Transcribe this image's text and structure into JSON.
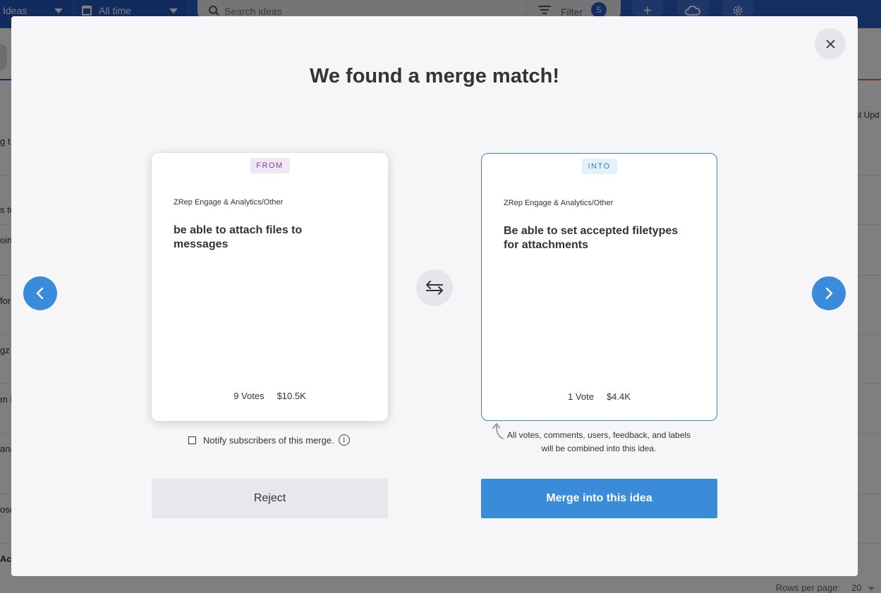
{
  "background": {
    "view_select": "Ideas",
    "date_range": "All time",
    "search_placeholder": "Search ideas",
    "filter_label": "Filter",
    "filter_count": "5",
    "column_fragment": "st Upd",
    "row_fragments": [
      "g t",
      "s to",
      "oin",
      "for",
      "gz",
      "m l",
      "ana",
      "osc",
      "Ac"
    ],
    "rows_per_page_label": "Rows per page:",
    "rows_per_page_value": "20"
  },
  "modal": {
    "title": "We found a merge match!",
    "from_card": {
      "tag": "FROM",
      "category": "ZRep Engage & Analytics/Other",
      "title": "be able to attach files to messages",
      "votes": "9 Votes",
      "value": "$10.5K"
    },
    "into_card": {
      "tag": "INTO",
      "category": "ZRep Engage & Analytics/Other",
      "title": "Be able to set accepted filetypes for attachments",
      "votes": "1 Vote",
      "value": "$4.4K"
    },
    "notify_label": "Notify subscribers of this merge.",
    "combine_note": "All votes, comments, users, feedback, and labels will be combined into this idea.",
    "reject_label": "Reject",
    "merge_label": "Merge into this idea"
  },
  "colors": {
    "primary": "#3a8bd8",
    "topbar": "#2a5cc5",
    "from_tag": "#8a3fa0",
    "into_tag": "#2a86b8"
  },
  "icons": [
    "calendar-icon",
    "search-icon",
    "filter-icon",
    "plus-icon",
    "cloud-icon",
    "gear-icon",
    "close-icon",
    "chevron-left-icon",
    "chevron-right-icon",
    "swap-icon",
    "info-icon",
    "curved-arrow-icon"
  ]
}
